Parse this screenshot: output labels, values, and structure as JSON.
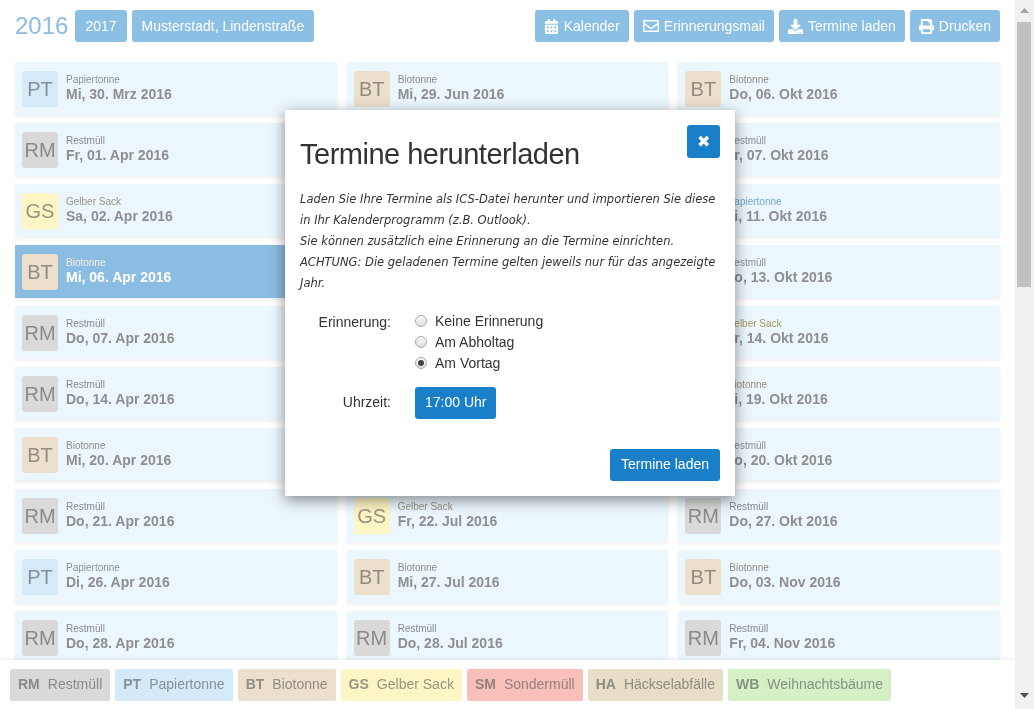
{
  "header": {
    "year": "2016",
    "year_buttons": [
      {
        "label": "2017"
      }
    ],
    "location": "Musterstadt, Lindenstraße",
    "actions": [
      {
        "kind": "calendar",
        "label": "Kalender"
      },
      {
        "kind": "mail",
        "label": "Erinnerungsmail"
      },
      {
        "kind": "download",
        "label": "Termine laden"
      },
      {
        "kind": "print",
        "label": "Drucken"
      }
    ]
  },
  "columns": [
    {
      "items": [
        {
          "code": "PT",
          "type": "Papiertonne",
          "date": "Mi, 30. Mrz 2016",
          "color": "#d4eaf8",
          "selected": false
        },
        {
          "code": "RM",
          "type": "Restmüll",
          "date": "Fr, 01. Apr 2016",
          "color": "#d9d9d9",
          "selected": false
        },
        {
          "code": "GS",
          "type": "Gelber Sack",
          "date": "Sa, 02. Apr 2016",
          "color": "#fdf5c4",
          "selected": false
        },
        {
          "code": "BT",
          "type": "Biotonne",
          "date": "Mi, 06. Apr 2016",
          "color": "#ece0cc",
          "selected": true
        },
        {
          "code": "RM",
          "type": "Restmüll",
          "date": "Do, 07. Apr 2016",
          "color": "#d9d9d9",
          "selected": false
        },
        {
          "code": "RM",
          "type": "Restmüll",
          "date": "Do, 14. Apr 2016",
          "color": "#d9d9d9",
          "selected": false
        },
        {
          "code": "BT",
          "type": "Biotonne",
          "date": "Mi, 20. Apr 2016",
          "color": "#ece0cc",
          "selected": false
        },
        {
          "code": "RM",
          "type": "Restmüll",
          "date": "Do, 21. Apr 2016",
          "color": "#d9d9d9",
          "selected": false
        },
        {
          "code": "PT",
          "type": "Papiertonne",
          "date": "Di, 26. Apr 2016",
          "color": "#d4eaf8",
          "selected": false
        },
        {
          "code": "RM",
          "type": "Restmüll",
          "date": "Do, 28. Apr 2016",
          "color": "#d9d9d9",
          "selected": false
        }
      ]
    },
    {
      "items": [
        {
          "code": "BT",
          "type": "Biotonne",
          "date": "Mi, 29. Jun 2016",
          "color": "#ece0cc",
          "selected": false
        },
        {
          "code": "GS",
          "type": "Gelber Sack",
          "date": "Fr, 22. Jul 2016",
          "color": "#fdf5c4",
          "selected": false
        },
        {
          "code": "BT",
          "type": "Biotonne",
          "date": "Mi, 27. Jul 2016",
          "color": "#ece0cc",
          "selected": false
        },
        {
          "code": "RM",
          "type": "Restmüll",
          "date": "Do, 28. Jul 2016",
          "color": "#d9d9d9",
          "selected": false
        }
      ]
    },
    {
      "items": [
        {
          "code": "BT",
          "type": "Biotonne",
          "date": "Do, 06. Okt 2016",
          "color": "#ece0cc",
          "selected": false
        },
        {
          "covered": true,
          "type": "estmüll",
          "date": "r, 07. Okt 2016",
          "color": "#8f8f8f",
          "selected": false
        },
        {
          "covered": true,
          "type": "apiertonne",
          "date": "i, 11. Okt 2016",
          "color": "#6fa8cf",
          "selected": false
        },
        {
          "covered": true,
          "type": "estmüll",
          "date": "o, 13. Okt 2016",
          "color": "#8f8f8f",
          "selected": false
        },
        {
          "covered": true,
          "type": "elber Sack",
          "date": "r, 14. Okt 2016",
          "color": "#a89a5a",
          "selected": false
        },
        {
          "covered": true,
          "type": "iotonne",
          "date": "i, 19. Okt 2016",
          "color": "#9c8e74",
          "selected": false
        },
        {
          "covered": true,
          "type": "estmüll",
          "date": "o, 20. Okt 2016",
          "color": "#8f8f8f",
          "selected": false
        },
        {
          "code": "RM",
          "type": "Restmüll",
          "date": "Do, 27. Okt 2016",
          "color": "#d9d9d9",
          "selected": false
        },
        {
          "code": "BT",
          "type": "Biotonne",
          "date": "Do, 03. Nov 2016",
          "color": "#ece0cc",
          "selected": false
        },
        {
          "code": "RM",
          "type": "Restmüll",
          "date": "Fr, 04. Nov 2016",
          "color": "#d9d9d9",
          "selected": false
        }
      ]
    }
  ],
  "legend": [
    {
      "code": "RM",
      "label": "Restmüll",
      "color": "#d9d9d9"
    },
    {
      "code": "PT",
      "label": "Papiertonne",
      "color": "#d4eaf8"
    },
    {
      "code": "BT",
      "label": "Biotonne",
      "color": "#ece0cc"
    },
    {
      "code": "GS",
      "label": "Gelber Sack",
      "color": "#fdf5c4"
    },
    {
      "code": "SM",
      "label": "Sondermüll",
      "color": "#f8c0b8"
    },
    {
      "code": "HA",
      "label": "Häckselabfälle",
      "color": "#e6dfc5"
    },
    {
      "code": "WB",
      "label": "Weihnachtsbäume",
      "color": "#d5f0c5"
    }
  ],
  "dialog": {
    "title": "Termine herunterladen",
    "close": "✖",
    "text": [
      "Laden Sie Ihre Termine als ICS-Datei herunter und importieren Sie diese in Ihr Kalenderprogramm (z.B. Outlook).",
      "Sie können zusätzlich eine Erinnerung an die Termine einrichten.",
      "ACHTUNG: Die geladenen Termine gelten jeweils nur für das angezeigte Jahr."
    ],
    "reminder_label": "Erinnerung:",
    "reminder_options": [
      {
        "label": "Keine Erinnerung",
        "selected": false
      },
      {
        "label": "Am Abholtag",
        "selected": false
      },
      {
        "label": "Am Vortag",
        "selected": true
      }
    ],
    "time_label": "Uhrzeit:",
    "time_value": "17:00 Uhr",
    "submit": "Termine laden"
  }
}
